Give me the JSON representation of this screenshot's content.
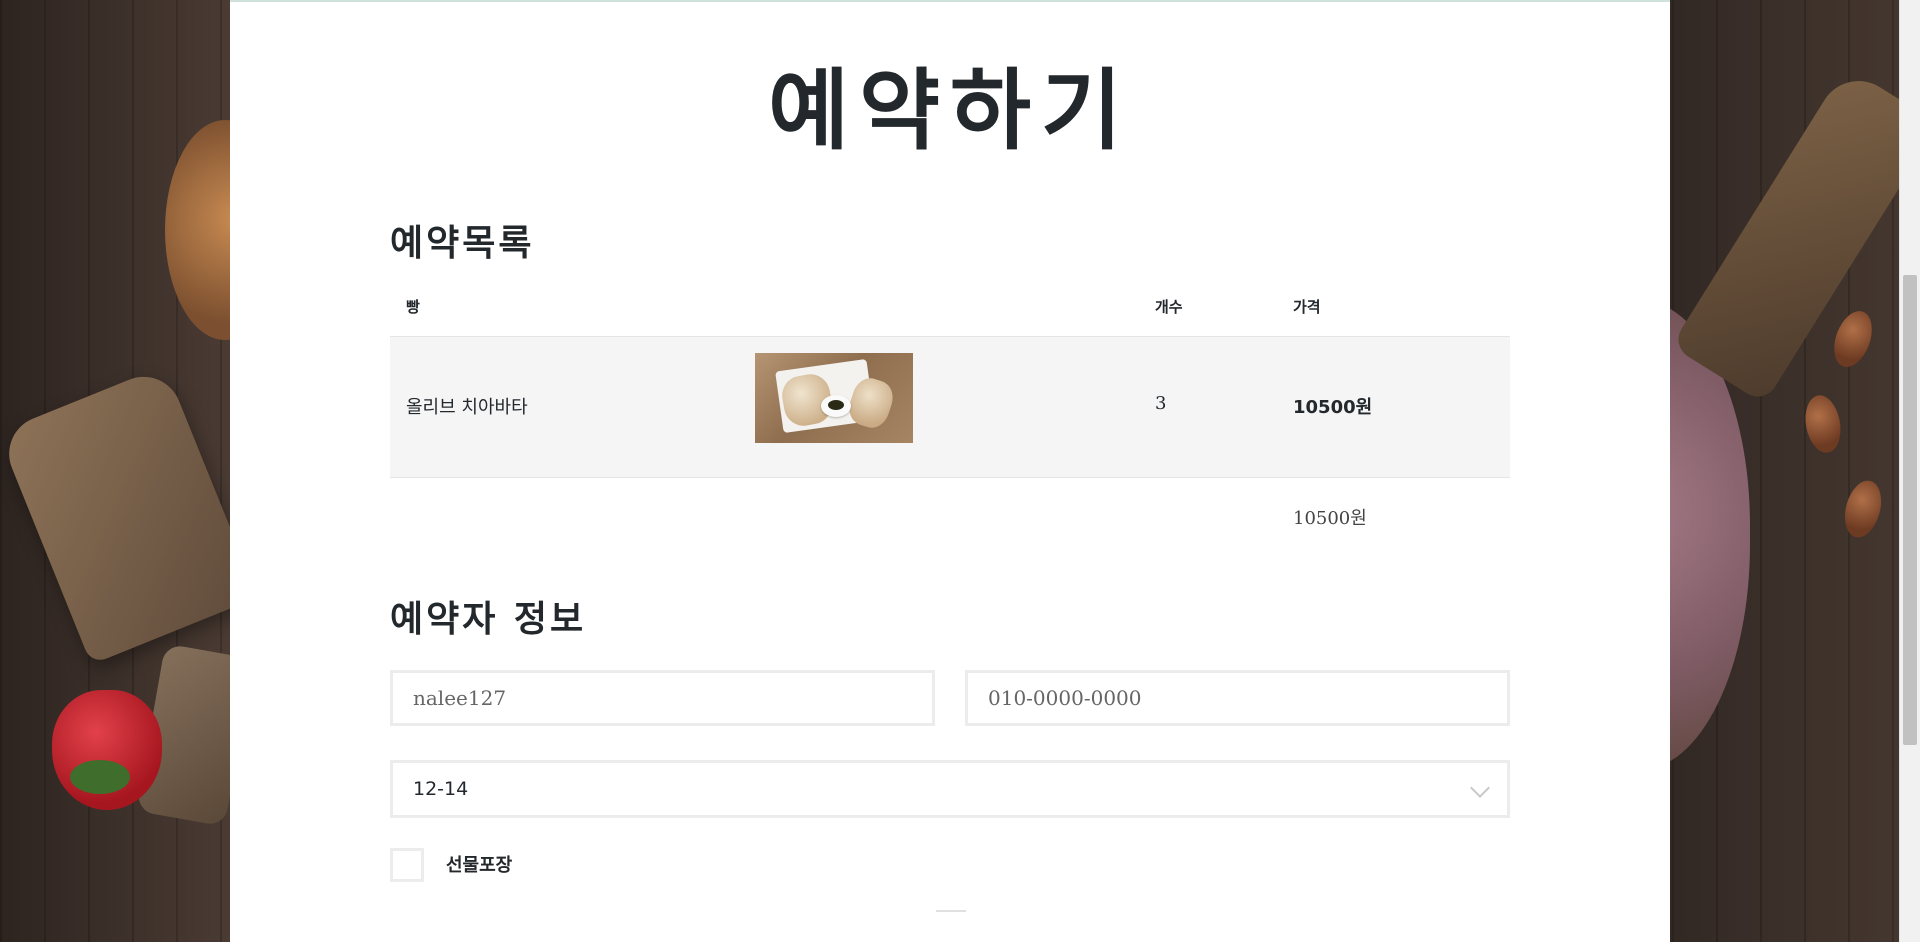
{
  "page": {
    "title": "예약하기"
  },
  "reservation_list": {
    "title": "예약목록",
    "columns": {
      "bread": "빵",
      "count": "개수",
      "price": "가격"
    },
    "items": [
      {
        "name": "올리브 치아바타",
        "count": "3",
        "price": "10500원"
      }
    ],
    "total": "10500원"
  },
  "customer_info": {
    "title": "예약자 정보",
    "id_field": {
      "value": "nalee127"
    },
    "phone_field": {
      "value": "010-0000-0000"
    },
    "time_select": {
      "value": "12-14"
    },
    "gift_wrap": {
      "label": "선물포장",
      "checked": false
    }
  },
  "icons": [
    "chevron-down-icon"
  ]
}
